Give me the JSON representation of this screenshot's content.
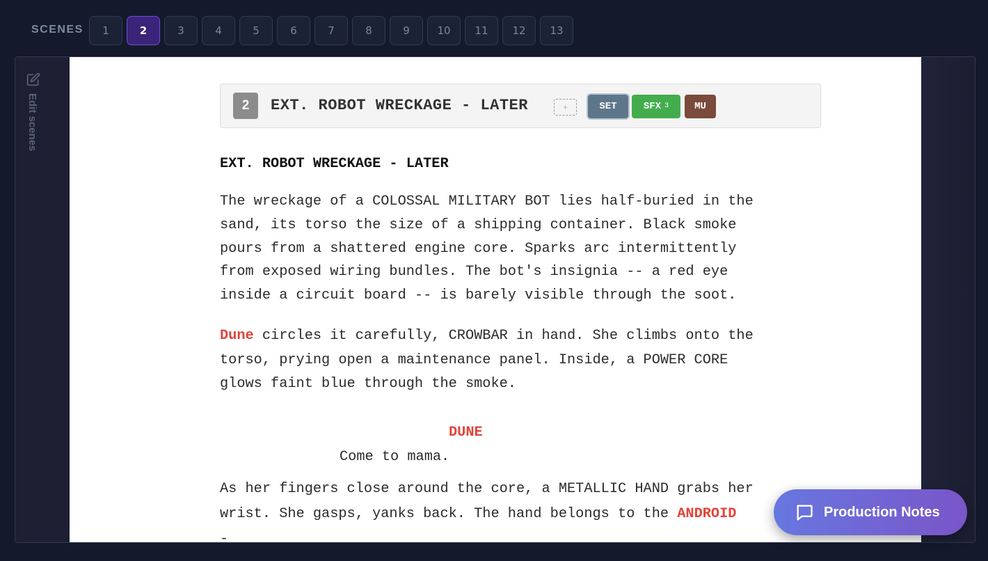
{
  "scenebar": {
    "label": "SCENES",
    "scenes": [
      "1",
      "2",
      "3",
      "4",
      "5",
      "6",
      "7",
      "8",
      "9",
      "10",
      "11",
      "12",
      "13"
    ],
    "active": "2"
  },
  "sidebar": {
    "edit_label": "Edit scenes",
    "icon": "edit-icon"
  },
  "scene_header": {
    "number": "2",
    "title": "EXT. ROBOT WRECKAGE - LATER",
    "add_tag": "+",
    "tags": [
      {
        "label": "SET",
        "count": "",
        "color": "#5e7689"
      },
      {
        "label": "SFX",
        "count": "3",
        "color": "#43ad4d"
      },
      {
        "label": "MU",
        "count": "",
        "color": "#7a4a3a"
      }
    ]
  },
  "script": {
    "slugline": "EXT. ROBOT WRECKAGE - LATER",
    "action1": "The wreckage of a COLOSSAL MILITARY BOT lies half-buried in the\nsand, its torso the size of a shipping container. Black smoke\npours from a shattered engine core. Sparks arc intermittently\nfrom exposed wiring bundles. The bot's insignia -- a red eye\ninside a circuit board -- is barely visible through the soot.",
    "action2_name": "Dune",
    "action2_rest": " circles it carefully, CROWBAR in hand. She climbs onto the\ntorso, prying open a maintenance panel. Inside, a POWER CORE\nglows faint blue through the smoke.",
    "cue": "DUNE",
    "dialogue": "Come to mama.",
    "action3_start": "As her fingers close around the core, a METALLIC HAND grabs her\nwrist. She gasps, yanks back. The hand belongs to the ",
    "action3_name": "ANDROID",
    "action3_end": "\n-"
  },
  "notes_button": {
    "label": "Production Notes",
    "icon": "chat-icon"
  },
  "colors": {
    "accent": "#6a4fd6",
    "character": "#e0443a"
  }
}
